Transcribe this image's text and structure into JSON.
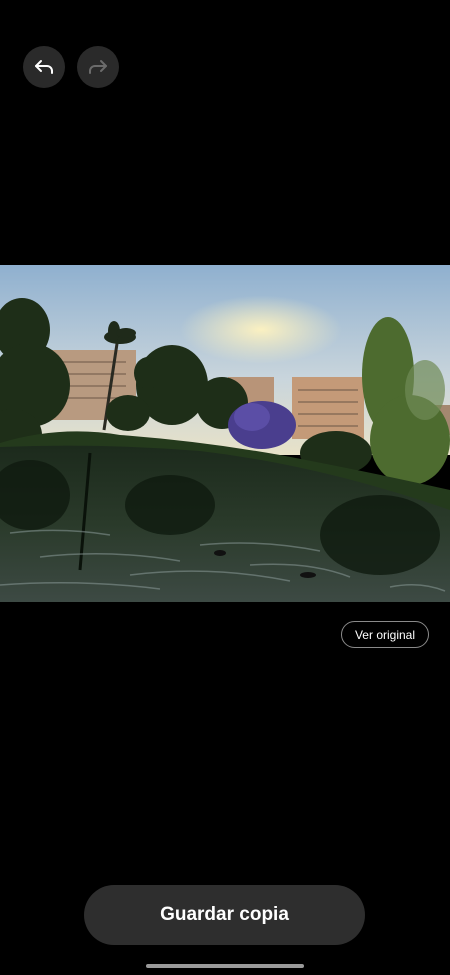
{
  "toolbar": {
    "undo_icon": "undo-arrow-icon",
    "redo_icon": "redo-arrow-icon",
    "redo_enabled": false
  },
  "photo": {
    "subject": "park-pond-photo"
  },
  "actions": {
    "view_original_label": "Ver original",
    "save_copy_label": "Guardar copia"
  },
  "colors": {
    "background": "#000000",
    "button_bg": "#2e2e2e",
    "icon_active": "#ffffff",
    "icon_disabled": "#6b6b6b"
  }
}
